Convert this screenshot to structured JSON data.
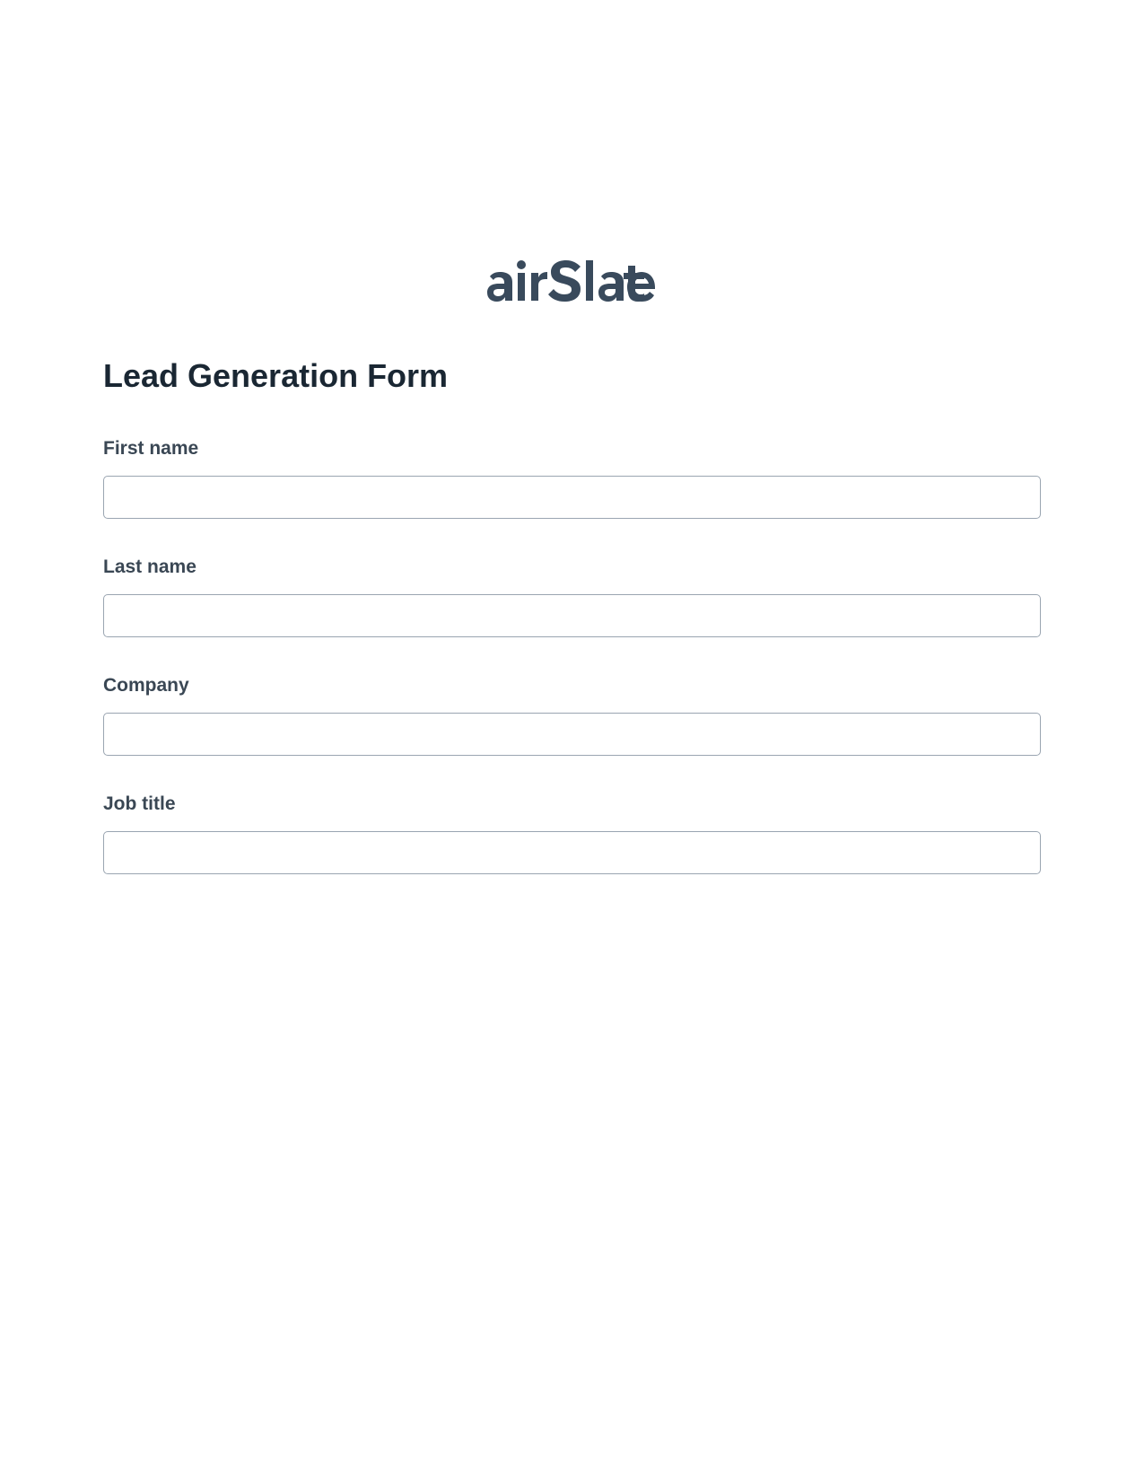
{
  "brand": {
    "name": "airSlate",
    "color": "#394a5c"
  },
  "form": {
    "title": "Lead Generation Form",
    "fields": [
      {
        "label": "First name",
        "value": ""
      },
      {
        "label": "Last name",
        "value": ""
      },
      {
        "label": "Company",
        "value": ""
      },
      {
        "label": "Job title",
        "value": ""
      }
    ]
  }
}
